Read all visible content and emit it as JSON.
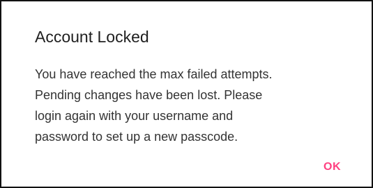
{
  "dialog": {
    "title": "Account Locked",
    "message_lines": [
      "You have reached the max failed attempts.",
      "Pending changes have been lost. Please",
      "login again with your username and",
      "password to set up a new passcode."
    ],
    "ok_label": "OK"
  },
  "colors": {
    "accent": "#ff4081",
    "border": "#111111",
    "title_text": "#1f1f1f",
    "body_text": "#333333"
  }
}
